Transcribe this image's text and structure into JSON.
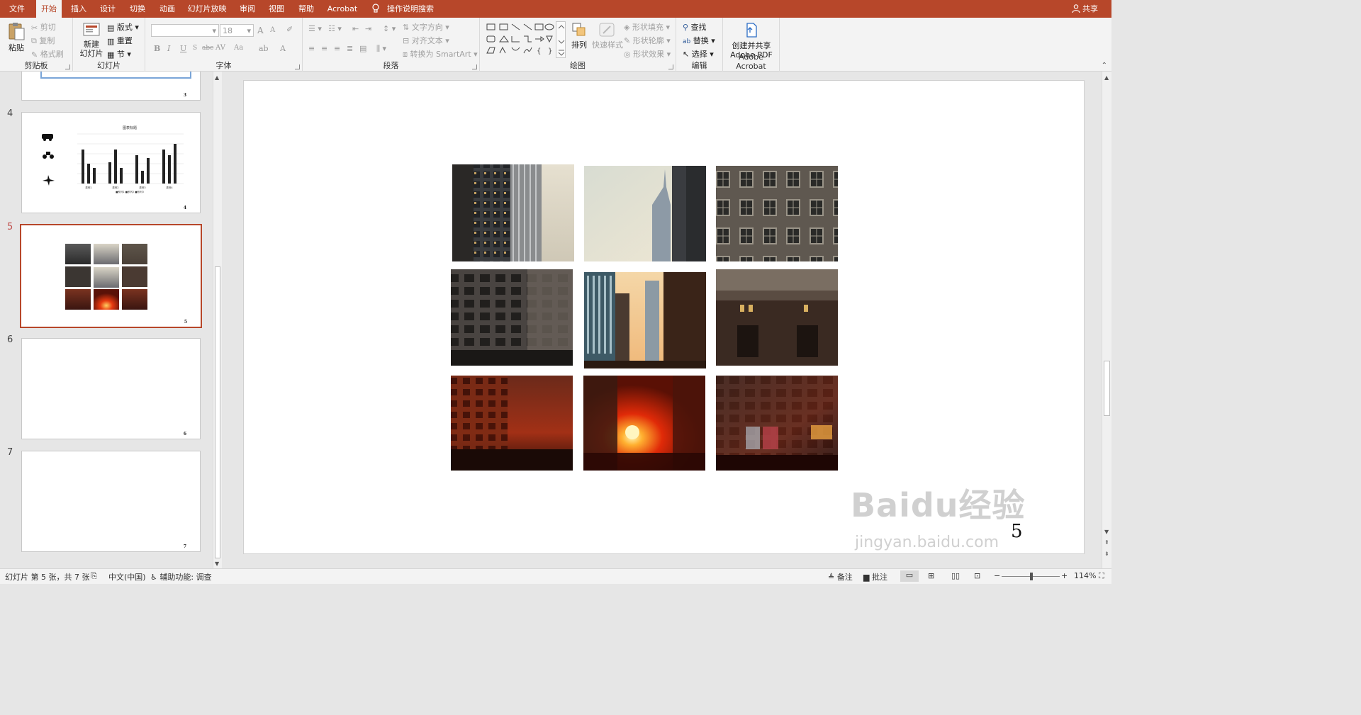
{
  "tabs": [
    {
      "label": "文件",
      "active": false
    },
    {
      "label": "开始",
      "active": true
    },
    {
      "label": "插入",
      "active": false
    },
    {
      "label": "设计",
      "active": false
    },
    {
      "label": "切换",
      "active": false
    },
    {
      "label": "动画",
      "active": false
    },
    {
      "label": "幻灯片放映",
      "active": false
    },
    {
      "label": "审阅",
      "active": false
    },
    {
      "label": "视图",
      "active": false
    },
    {
      "label": "帮助",
      "active": false
    },
    {
      "label": "Acrobat",
      "active": false
    }
  ],
  "tell_me": "操作说明搜索",
  "share": "共享",
  "ribbon": {
    "clipboard": {
      "label": "剪贴板",
      "paste": "粘贴",
      "cut": "剪切",
      "copy": "复制",
      "format_painter": "格式刷"
    },
    "slides": {
      "label": "幻灯片",
      "new_slide_1": "新建",
      "new_slide_2": "幻灯片",
      "layout": "版式",
      "reset": "重置",
      "section": "节"
    },
    "font": {
      "label": "字体",
      "font_size": "18",
      "grow": "A",
      "shrink": "A",
      "bold": "B",
      "italic": "I",
      "underline": "U",
      "strike": "abc",
      "spacing": "AV",
      "case": "Aa",
      "color": "A"
    },
    "paragraph": {
      "label": "段落",
      "text_direction": "文字方向",
      "align_text": "对齐文本",
      "smartart": "转换为 SmartArt"
    },
    "drawing": {
      "label": "绘图",
      "arrange": "排列",
      "quick_styles": "快速样式",
      "shape_fill": "形状填充",
      "shape_outline": "形状轮廓",
      "shape_effects": "形状效果"
    },
    "editing": {
      "label": "编辑",
      "find": "查找",
      "replace": "替换",
      "select": "选择"
    },
    "acrobat": {
      "label": "Adobe Acrobat",
      "create_1": "创建并共享",
      "create_2": "Adobe PDF"
    }
  },
  "thumbnails": [
    {
      "number": "",
      "page_label": "3"
    },
    {
      "number": "4",
      "page_label": "4",
      "chart_title": "图表标题",
      "legend": "■系列1 ■系列2 ■系列3",
      "categories": [
        "类别1",
        "类别2",
        "类别3",
        "类别4"
      ]
    },
    {
      "number": "5",
      "page_label": "5",
      "selected": true
    },
    {
      "number": "6",
      "page_label": "6"
    },
    {
      "number": "7",
      "page_label": "7"
    }
  ],
  "slide": {
    "page_number": "5",
    "grid_caption": ""
  },
  "watermark": {
    "line1": "Baidu经验",
    "line2": "jingyan.baidu.com"
  },
  "status": {
    "slide_info": "幻灯片 第 5 张，共 7 张",
    "language": "中文(中国)",
    "accessibility": "辅助功能: 调查",
    "notes": "备注",
    "comments": "批注",
    "zoom": "114%"
  },
  "colors": {
    "accent": "#b7472a",
    "ribbon_bg": "#f3f3f3",
    "workspace": "#e6e6e6"
  }
}
